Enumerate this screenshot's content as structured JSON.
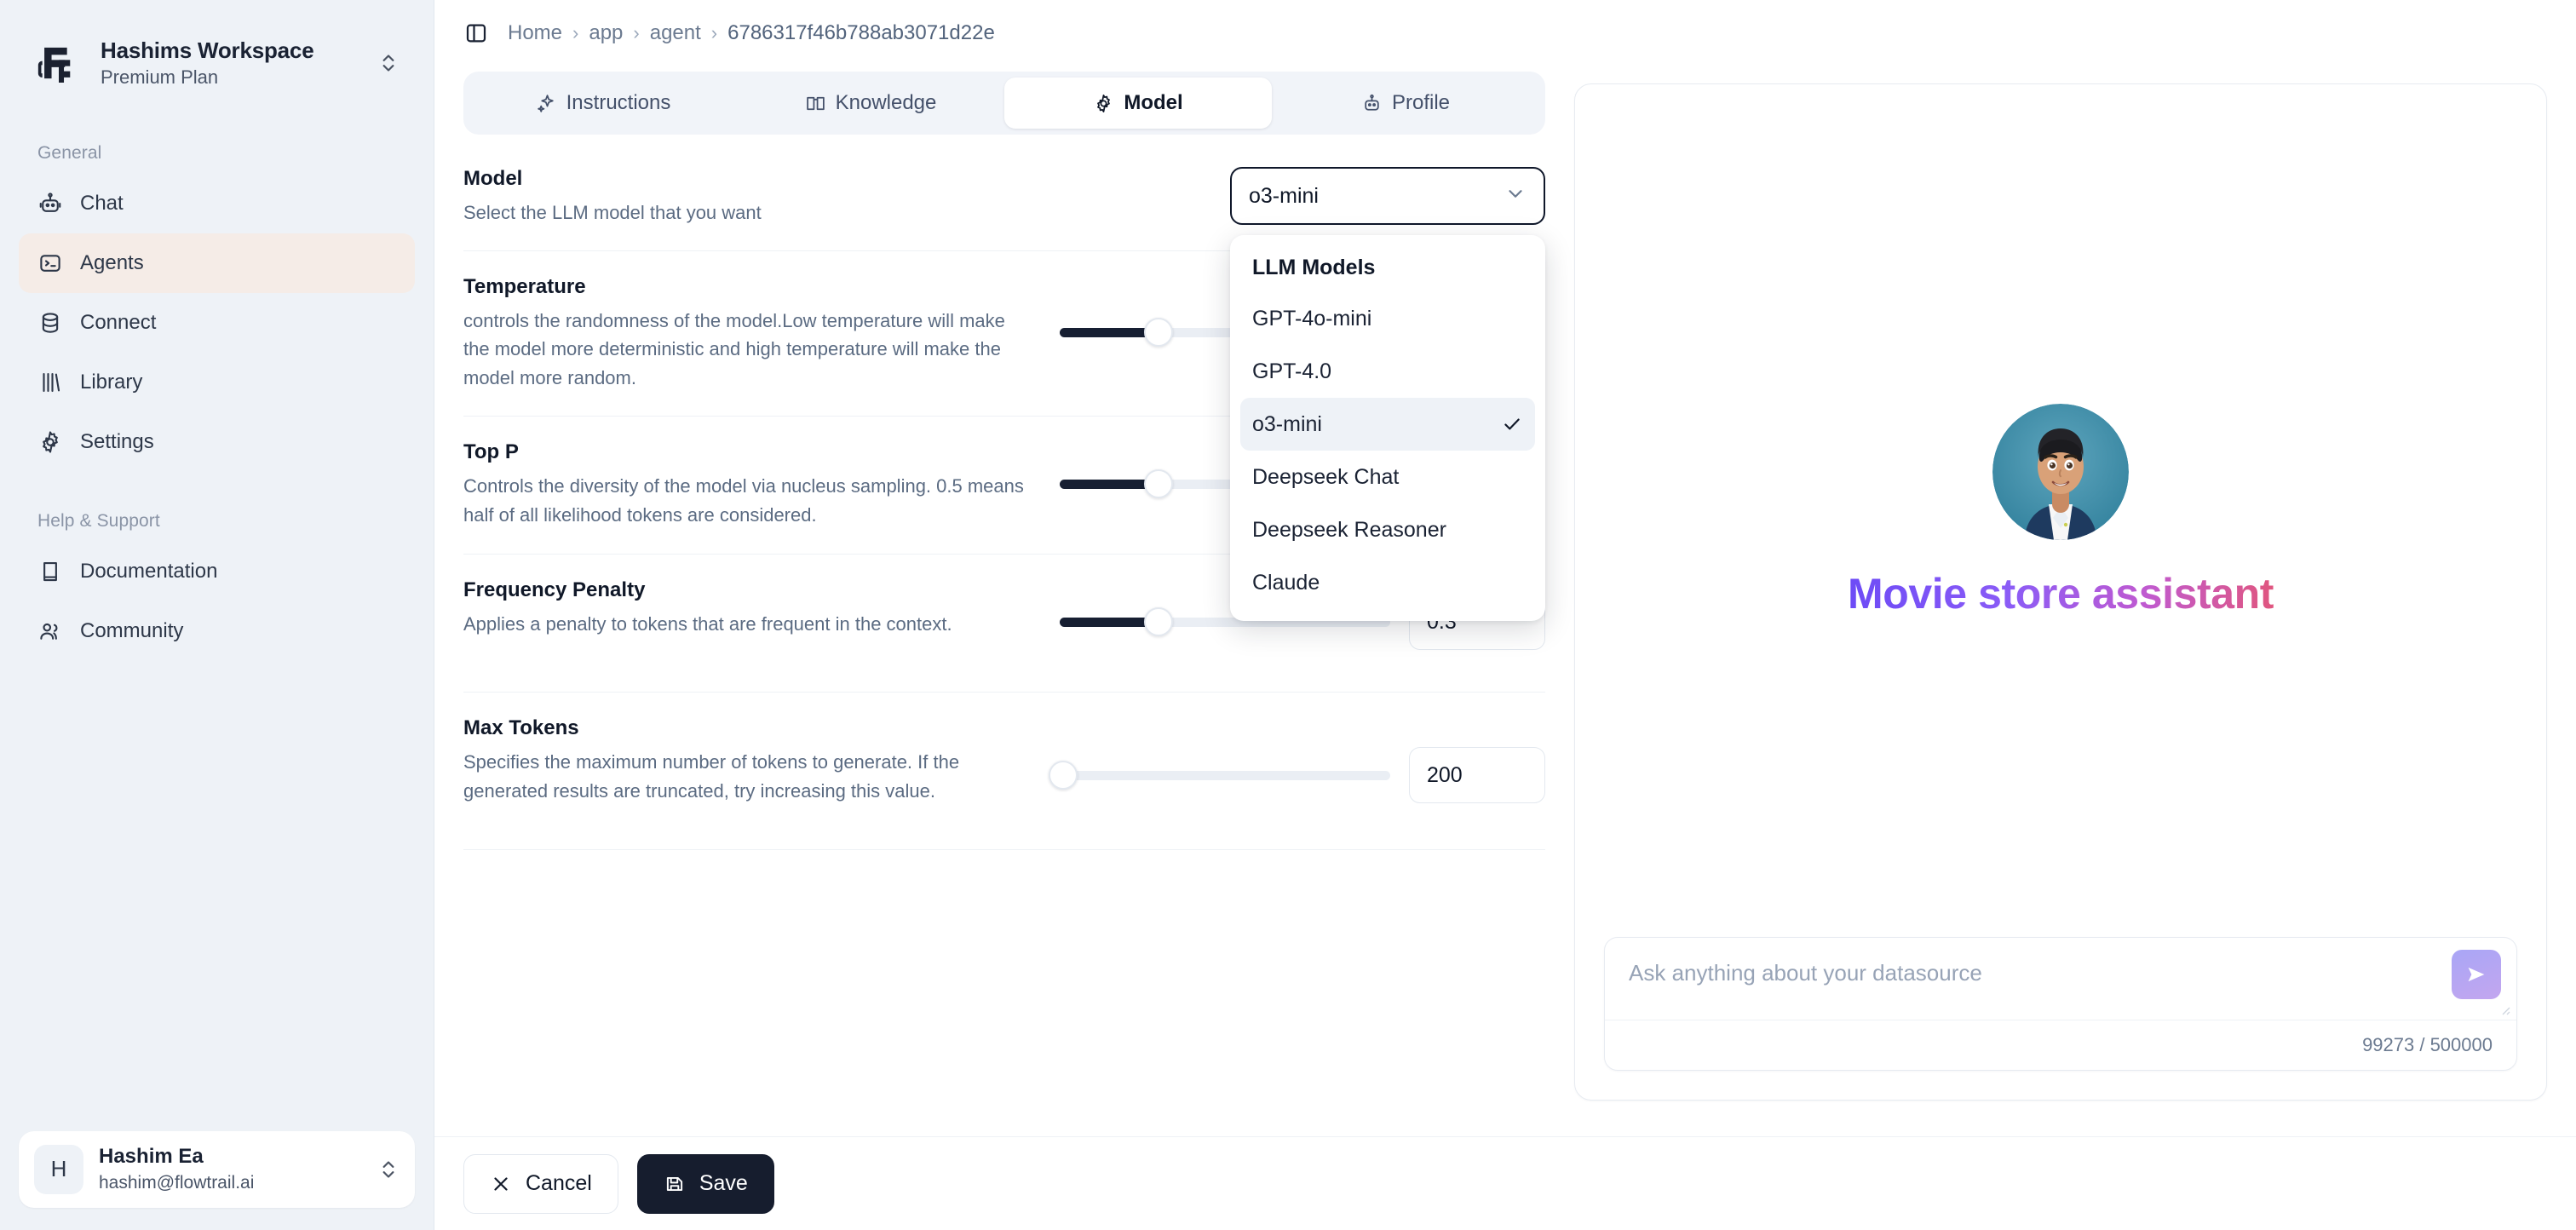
{
  "workspace": {
    "name": "Hashims Workspace",
    "plan": "Premium Plan",
    "logo_icon": "flowtrail-logo-icon",
    "switch_icon": "chevron-up-down-icon"
  },
  "sidebar": {
    "groups": [
      {
        "label": "General",
        "items": [
          {
            "label": "Chat",
            "icon": "bot-icon",
            "active": false
          },
          {
            "label": "Agents",
            "icon": "terminal-square-icon",
            "active": true
          },
          {
            "label": "Connect",
            "icon": "database-icon",
            "active": false
          },
          {
            "label": "Library",
            "icon": "library-icon",
            "active": false
          },
          {
            "label": "Settings",
            "icon": "gear-icon",
            "active": false
          }
        ]
      },
      {
        "label": "Help & Support",
        "items": [
          {
            "label": "Documentation",
            "icon": "book-icon",
            "active": false
          },
          {
            "label": "Community",
            "icon": "users-icon",
            "active": false
          }
        ]
      }
    ],
    "user": {
      "initial": "H",
      "name": "Hashim Ea",
      "email": "hashim@flowtrail.ai",
      "switch_icon": "chevron-up-down-icon"
    }
  },
  "topbar": {
    "panel_toggle_icon": "panel-left-icon",
    "breadcrumb": [
      "Home",
      "app",
      "agent",
      "6786317f46b788ab3071d22e"
    ],
    "separator": "›"
  },
  "tabs": [
    {
      "label": "Instructions",
      "icon": "sparkles-icon",
      "active": false
    },
    {
      "label": "Knowledge",
      "icon": "book-open-icon",
      "active": false
    },
    {
      "label": "Model",
      "icon": "cog-icon",
      "active": true
    },
    {
      "label": "Profile",
      "icon": "bot-icon",
      "active": false
    }
  ],
  "settings": {
    "model": {
      "title": "Model",
      "description": "Select the LLM model that you want",
      "selected": "o3-mini",
      "chevron_icon": "chevron-down-icon",
      "menu": {
        "title": "LLM Models",
        "check_icon": "check-icon",
        "options": [
          {
            "label": "GPT-4o-mini",
            "selected": false
          },
          {
            "label": "GPT-4.0",
            "selected": false
          },
          {
            "label": "o3-mini",
            "selected": true
          },
          {
            "label": "Deepseek Chat",
            "selected": false
          },
          {
            "label": "Deepseek Reasoner",
            "selected": false
          },
          {
            "label": "Claude",
            "selected": false
          }
        ]
      }
    },
    "temperature": {
      "title": "Temperature",
      "description": "controls the randomness of the model.Low temperature will make the model more deterministic and high temperature will make the model more random.",
      "percent": 30
    },
    "top_p": {
      "title": "Top P",
      "description": "Controls the diversity of the model via nucleus sampling. 0.5 means half of all likelihood tokens are considered.",
      "percent": 30
    },
    "frequency_penalty": {
      "title": "Frequency Penalty",
      "description": "Applies a penalty to tokens that are frequent in the context.",
      "value": "0.3",
      "percent": 30
    },
    "max_tokens": {
      "title": "Max Tokens",
      "description": "Specifies the maximum number of tokens to generate. If the generated results are truncated, try increasing this value.",
      "value": "200",
      "percent": 1
    }
  },
  "preview": {
    "avatar_icon": "agent-avatar-image",
    "title": "Movie store assistant",
    "title_gradient_from": "#6d4bf6",
    "title_gradient_to": "#e0567f",
    "chat": {
      "placeholder": "Ask anything about your datasource",
      "send_icon": "send-icon",
      "counter": "99273 / 500000"
    }
  },
  "footer": {
    "cancel_label": "Cancel",
    "cancel_icon": "close-icon",
    "save_label": "Save",
    "save_icon": "save-icon"
  }
}
